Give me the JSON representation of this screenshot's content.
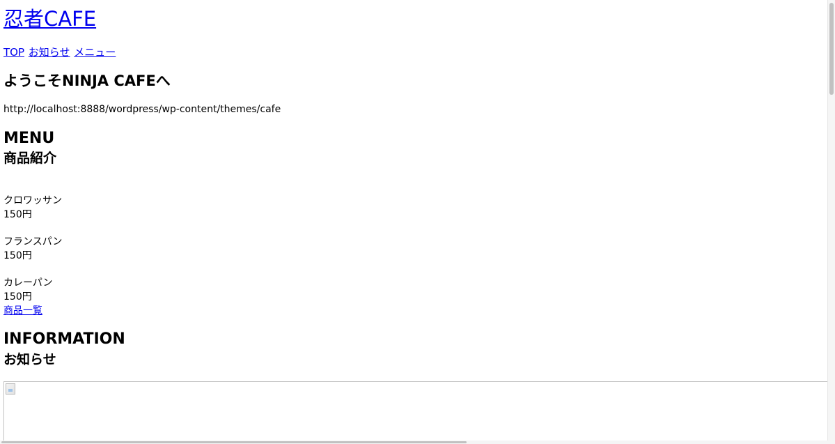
{
  "site": {
    "title": "忍者CAFE"
  },
  "nav": {
    "items": [
      {
        "label": "TOP"
      },
      {
        "label": "お知らせ"
      },
      {
        "label": "メニュー"
      }
    ]
  },
  "main": {
    "welcome_heading": "ようこそNINJA CAFEへ",
    "theme_path": "http://localhost:8888/wordpress/wp-content/themes/cafe",
    "menu_section": {
      "title": "MENU",
      "subtitle": "商品紹介",
      "items": [
        {
          "name": "クロワッサン",
          "price": "150円"
        },
        {
          "name": "フランスパン",
          "price": "150円"
        },
        {
          "name": "カレーパン",
          "price": "150円"
        }
      ],
      "all_link": "商品一覧"
    },
    "info_section": {
      "title": "INFORMATION",
      "subtitle": "お知らせ"
    }
  },
  "colors": {
    "link": "#0000ee",
    "text": "#000000",
    "background": "#ffffff"
  }
}
